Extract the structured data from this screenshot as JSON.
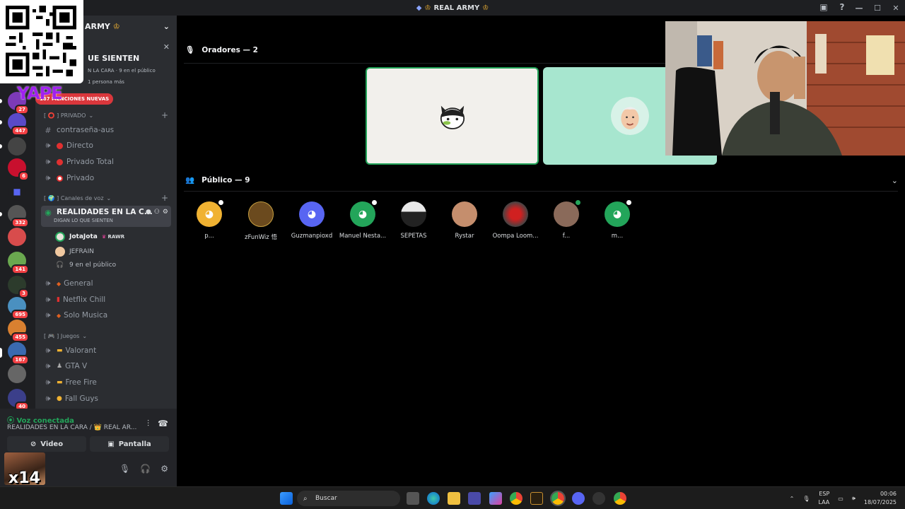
{
  "window": {
    "title": "REAL ARMY"
  },
  "guild": {
    "name": "ARMY"
  },
  "event": {
    "title": "UE SIENTEN",
    "sub": "N LA CARA · 9 en el público",
    "sub2": "1 persona más"
  },
  "overlay": {
    "brand": "YAPE"
  },
  "mentions": "167 MENCIONES NUEVAS",
  "server_badges": [
    "27",
    "447",
    "6",
    "332",
    "141",
    "3",
    "695",
    "455",
    "167",
    "40"
  ],
  "categories": {
    "private": "[ ⭕ ] PRIVADO",
    "voice": "[ 🌍 ] Canales de voz",
    "games": "[ 🎮 ] Juegos"
  },
  "channels": {
    "password": "contraseña-aus",
    "direct": "Directo",
    "private_total": "Privado Total",
    "private": "Privado",
    "stage_name": "REALIDADES EN LA C...",
    "stage_topic": "DIGAN LO QUE SIENTEN",
    "general": "General",
    "netflix": "Netflix Chill",
    "music": "Solo Musica",
    "valorant": "Valorant",
    "gta": "GTA V",
    "freefire": "Free Fire",
    "fallguys": "Fall Guys"
  },
  "stage_members": {
    "speaker1": "JotaJota",
    "speaker1_tag": "RAWR",
    "speaker2": "JEFRAIN",
    "audience": "9 en el público"
  },
  "voice_panel": {
    "status": "Voz conectada",
    "location": "REALIDADES EN LA CARA / 👑 REAL AR...",
    "video": "Video",
    "screen": "Pantalla",
    "overlay_text": "x14"
  },
  "stage": {
    "speakers_header": "Oradores — 2",
    "audience_header": "Público — 9",
    "audience": [
      {
        "name": "p...",
        "color": "#f0b232",
        "mod": true
      },
      {
        "name": "zFunWiz 悟",
        "color": "#6b4a1e",
        "mod": false
      },
      {
        "name": "Guzmanpioxd",
        "color": "#5865f2",
        "mod": false
      },
      {
        "name": "Manuel Nesta...",
        "color": "#23a55a",
        "mod": true
      },
      {
        "name": "SEPETAS",
        "color": "#e8e8e8",
        "mod": false
      },
      {
        "name": "Rystar",
        "color": "#c58e6d",
        "mod": false
      },
      {
        "name": "Oompa Loom...",
        "color": "#b02020",
        "mod": false
      },
      {
        "name": "f...",
        "color": "#8a6a5a",
        "mod": true
      },
      {
        "name": "m...",
        "color": "#23a55a",
        "mod": true
      }
    ]
  },
  "taskbar": {
    "search": "Buscar",
    "lang1": "ESP",
    "lang2": "LAA",
    "time": "00:06",
    "date": "18/07/2025"
  }
}
